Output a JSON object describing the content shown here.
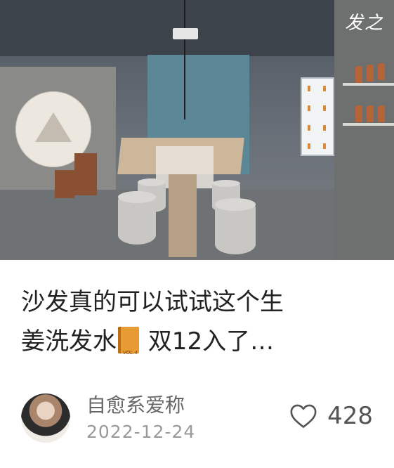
{
  "cover": {
    "brand_mark": "发之"
  },
  "post": {
    "title_line1": "沙发真的可以试试这个生",
    "title_line2_a": "姜洗发水",
    "title_line2_b": "双12入了…",
    "book_icon": "book-icon"
  },
  "author": {
    "name": "自愈系爱称",
    "date": "2022-12-24",
    "avatar_icon": "avatar"
  },
  "stats": {
    "likes": "428",
    "like_icon": "heart-outline-icon"
  }
}
